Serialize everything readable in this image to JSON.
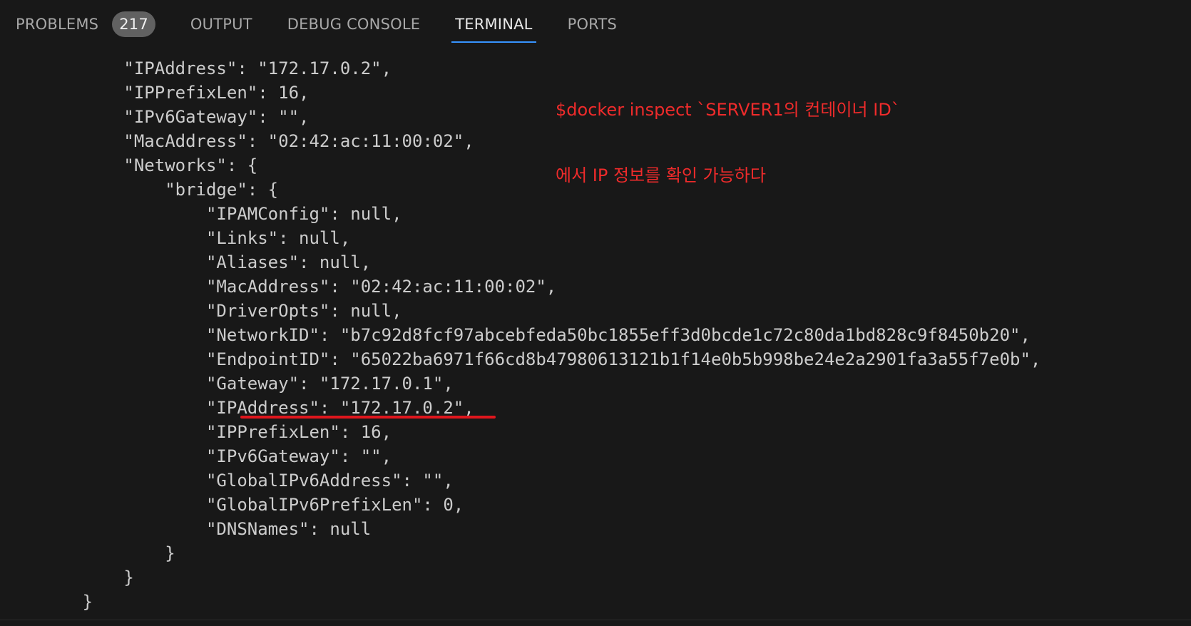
{
  "tabs": [
    {
      "label": "PROBLEMS",
      "badge": "217",
      "active": false
    },
    {
      "label": "OUTPUT",
      "active": false
    },
    {
      "label": "DEBUG CONSOLE",
      "active": false
    },
    {
      "label": "TERMINAL",
      "active": true
    },
    {
      "label": "PORTS",
      "active": false
    }
  ],
  "terminal_lines": [
    "            \"IPAddress\": \"172.17.0.2\",",
    "            \"IPPrefixLen\": 16,",
    "            \"IPv6Gateway\": \"\",",
    "            \"MacAddress\": \"02:42:ac:11:00:02\",",
    "            \"Networks\": {",
    "                \"bridge\": {",
    "                    \"IPAMConfig\": null,",
    "                    \"Links\": null,",
    "                    \"Aliases\": null,",
    "                    \"MacAddress\": \"02:42:ac:11:00:02\",",
    "                    \"DriverOpts\": null,",
    "                    \"NetworkID\": \"b7c92d8fcf97abcebfeda50bc1855eff3d0bcde1c72c80da1bd828c9f8450b20\",",
    "                    \"EndpointID\": \"65022ba6971f66cd8b47980613121b1f14e0b5b998be24e2a2901fa3a55f7e0b\",",
    "                    \"Gateway\": \"172.17.0.1\",",
    "                    \"IPAddress\": \"172.17.0.2\",",
    "                    \"IPPrefixLen\": 16,",
    "                    \"IPv6Gateway\": \"\",",
    "                    \"GlobalIPv6Address\": \"\",",
    "                    \"GlobalIPv6PrefixLen\": 0,",
    "                    \"DNSNames\": null",
    "                }",
    "            }",
    "        }"
  ],
  "annotations": {
    "line1": "$docker inspect `SERVER1의 컨테이너 ID`",
    "line2": "에서 IP 정보를 확인 가능하다"
  },
  "colors": {
    "background": "#181818",
    "tab_active_underline": "#3794ff",
    "annotation": "#ef2b2b",
    "highlight_underline": "#e0161d"
  }
}
